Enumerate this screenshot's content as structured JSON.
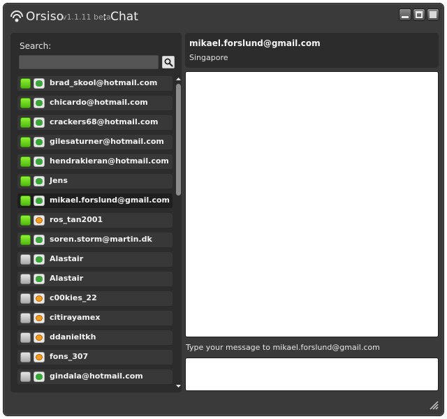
{
  "app": {
    "name": "Orsiso",
    "version": "v1.1.11 beta",
    "title_separator": ": Chat"
  },
  "search": {
    "label": "Search:",
    "value": "",
    "placeholder": ""
  },
  "contacts": [
    {
      "name": "brad_skool@hotmail.com",
      "status": "online",
      "protocol": "msn"
    },
    {
      "name": "chicardo@hotmail.com",
      "status": "online",
      "protocol": "msn"
    },
    {
      "name": "crackers68@hotmail.com",
      "status": "online",
      "protocol": "msn"
    },
    {
      "name": "gilesaturner@hotmail.com",
      "status": "online",
      "protocol": "msn"
    },
    {
      "name": "hendrakieran@hotmail.com",
      "status": "online",
      "protocol": "msn"
    },
    {
      "name": "Jens",
      "status": "online",
      "protocol": "msn"
    },
    {
      "name": "mikael.forslund@gmail.com",
      "status": "online",
      "protocol": "msn",
      "selected": true
    },
    {
      "name": "ros_tan2001",
      "status": "online",
      "protocol": "yahoo"
    },
    {
      "name": "soren.storm@martin.dk",
      "status": "online",
      "protocol": "msn"
    },
    {
      "name": "Alastair",
      "status": "offline",
      "protocol": "msn"
    },
    {
      "name": "Alastair",
      "status": "offline",
      "protocol": "msn"
    },
    {
      "name": "c00kies_22",
      "status": "offline",
      "protocol": "yahoo"
    },
    {
      "name": "citirayamex",
      "status": "offline",
      "protocol": "yahoo"
    },
    {
      "name": "ddanieltkh",
      "status": "offline",
      "protocol": "yahoo"
    },
    {
      "name": "fons_307",
      "status": "offline",
      "protocol": "yahoo"
    },
    {
      "name": "gindala@hotmail.com",
      "status": "offline",
      "protocol": "msn"
    }
  ],
  "chat": {
    "peer_email": "mikael.forslund@gmail.com",
    "peer_location": "Singapore",
    "input_prompt": "Type your message to mikael.forslund@gmail.com",
    "message_value": ""
  },
  "colors": {
    "online": "#6fd61f",
    "offline": "#c4c4c4",
    "window": "#3a3a3a",
    "panel": "#2c2c2c"
  },
  "icons": {
    "logo": "signal-waves-icon",
    "search": "magnifier-icon",
    "msn_protocol": "msn-buddy-icon",
    "yahoo_protocol": "yahoo-smiley-icon",
    "minimize": "minimize-icon",
    "maximize": "maximize-icon",
    "close": "close-icon",
    "resize": "resize-grip-icon"
  }
}
